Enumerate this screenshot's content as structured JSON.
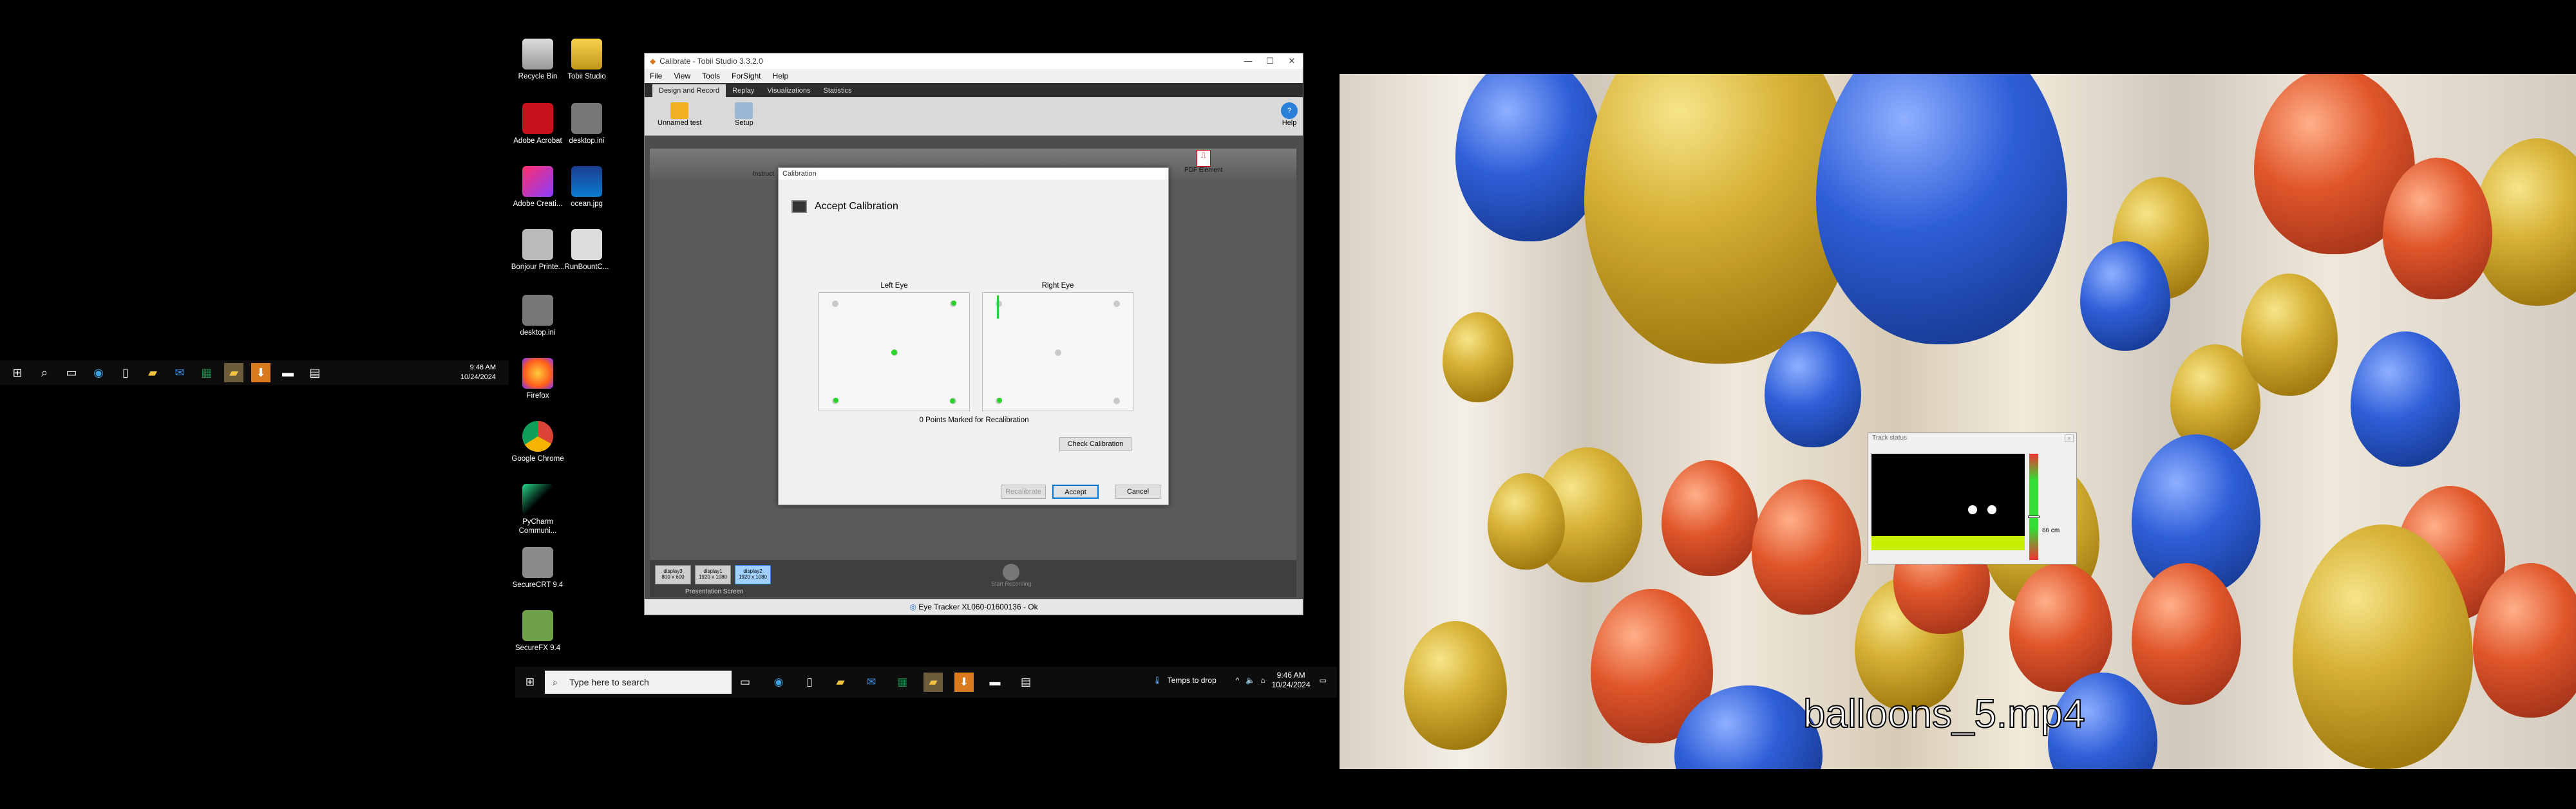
{
  "left_taskbar": {
    "time": "9:46 AM",
    "date": "10/24/2024"
  },
  "desktop_icons": [
    {
      "label": "Recycle Bin"
    },
    {
      "label": "Tobii Studio"
    },
    {
      "label": "Adobe Acrobat"
    },
    {
      "label": "desktop.ini"
    },
    {
      "label": "Adobe Creati..."
    },
    {
      "label": "ocean.jpg"
    },
    {
      "label": "Bonjour Printe..."
    },
    {
      "label": "RunBountC..."
    },
    {
      "label": "desktop.ini"
    },
    {
      "label": "Firefox"
    },
    {
      "label": "Google Chrome"
    },
    {
      "label": "PyCharm Communi..."
    },
    {
      "label": "SecureCRT 9.4"
    },
    {
      "label": "SecureFX 9.4"
    }
  ],
  "tobii": {
    "title": "Calibrate - Tobii Studio 3.3.2.0",
    "menu": [
      "File",
      "View",
      "Tools",
      "ForSight",
      "Help"
    ],
    "tabs": [
      "Design and Record",
      "Replay",
      "Visualizations",
      "Statistics"
    ],
    "ribbon": {
      "test_label": "Unnamed test",
      "setup_label": "Setup",
      "help_label": "Help"
    },
    "toolstrip_labels": {
      "instruction": "Instruct",
      "pdf": "PDF Element"
    },
    "displays": [
      {
        "name": "display3",
        "res": "800 x 600"
      },
      {
        "name": "display1",
        "res": "1920 x 1080"
      },
      {
        "name": "display2",
        "res": "1920 x 1080"
      }
    ],
    "presentation_label": "Presentation Screen",
    "start_rec": "Start Recording",
    "status": "Eye Tracker XL060-01600136 - Ok"
  },
  "calibration": {
    "window_title": "Calibration",
    "heading": "Accept Calibration",
    "left_label": "Left Eye",
    "right_label": "Right Eye",
    "points_text": "0 Points Marked for Recalibration",
    "check_btn": "Check Calibration",
    "recalibrate_btn": "Recalibrate",
    "accept_btn": "Accept",
    "cancel_btn": "Cancel"
  },
  "mid_taskbar": {
    "search_placeholder": "Type here to search",
    "weather": "Temps to drop",
    "time": "9:46 AM",
    "date": "10/24/2024"
  },
  "video": {
    "caption": "balloons_5.mp4"
  },
  "track_status": {
    "title": "Track status",
    "distance": "66 cm"
  },
  "colors": {
    "gaze_green": "#2bd32b",
    "track_bar": "#c6f000",
    "accent_blue": "#0078d7"
  }
}
